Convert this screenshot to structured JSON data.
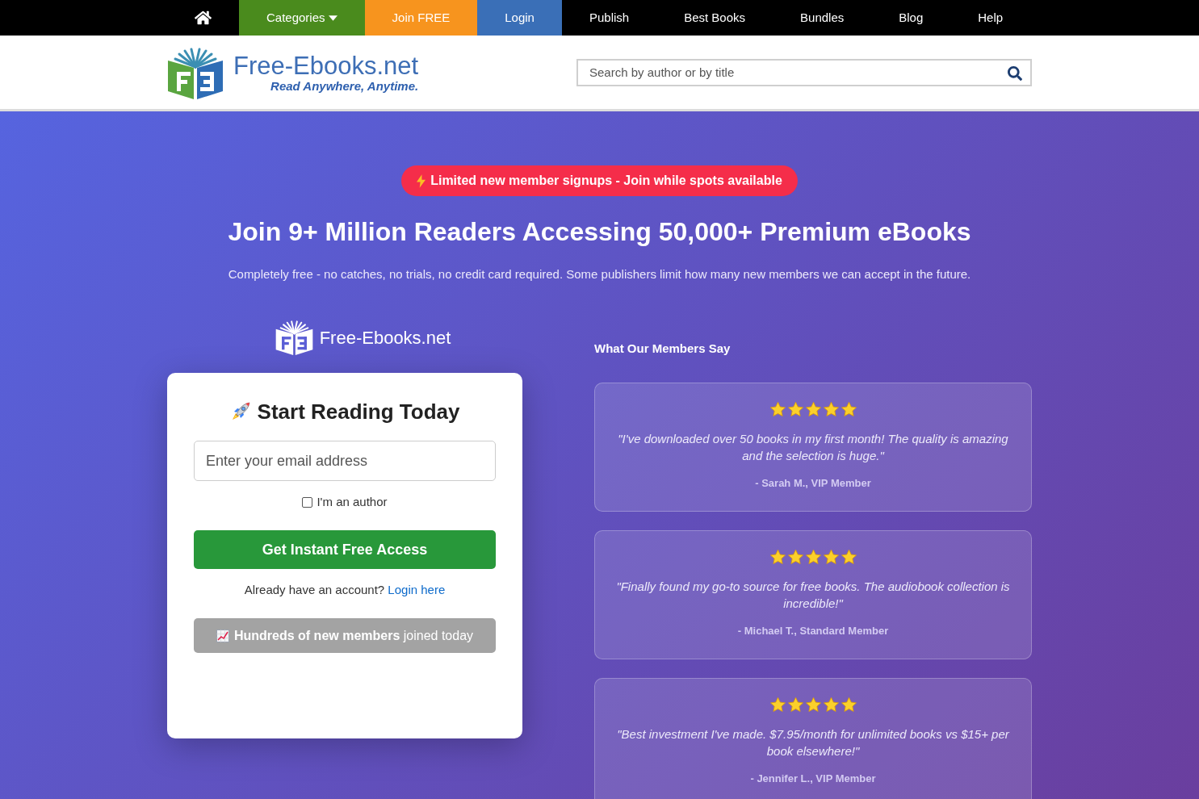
{
  "nav": {
    "items": [
      {
        "kind": "home"
      },
      {
        "kind": "menu",
        "label": "Categories",
        "color": "#4a8b1d"
      },
      {
        "kind": "link",
        "label": "Join FREE",
        "color": "#f7941e"
      },
      {
        "kind": "link",
        "label": "Login",
        "color": "#3a6fb7"
      },
      {
        "kind": "link",
        "label": "Publish"
      },
      {
        "kind": "link",
        "label": "Best Books"
      },
      {
        "kind": "link",
        "label": "Bundles"
      },
      {
        "kind": "link",
        "label": "Blog"
      },
      {
        "kind": "link",
        "label": "Help"
      }
    ]
  },
  "header": {
    "logo": {
      "name": "Free-Ebooks.net",
      "tagline": "Read Anywhere, Anytime."
    },
    "search": {
      "placeholder": "Search by author or by title"
    }
  },
  "hero": {
    "alert": "Limited new member signups - Join while spots available",
    "title": "Join 9+ Million Readers Accessing 50,000+ Premium eBooks",
    "subtitle": "Completely free - no catches, no trials, no credit card required. Some publishers limit how many new members we can accept in the future."
  },
  "signup": {
    "logo": {
      "name": "Free-Ebooks.net"
    },
    "title": "Start Reading Today",
    "email": {
      "placeholder": "Enter your email address"
    },
    "author_checkbox": {
      "label": "I'm an author",
      "checked": false
    },
    "submit": "Get Instant Free Access",
    "login_prompt": "Already have an account?",
    "login_link": "Login here",
    "social_proof": "**Hundreds of new members** joined today"
  },
  "testimonials": {
    "title": "What Our Members Say",
    "items": [
      {
        "stars": 5,
        "quote": "\"I've downloaded over 50 books in my first month! The quality is amazing and the selection is huge.\"",
        "author": "- Sarah M., VIP Member"
      },
      {
        "stars": 5,
        "quote": "\"Finally found my go-to source for free books. The audiobook collection is incredible!\"",
        "author": "- Michael T., Standard Member"
      },
      {
        "stars": 5,
        "quote": "\"Best investment I've made. $7.95/month for unlimited books vs $15+ per book elsewhere!\"",
        "author": "- Jennifer L., VIP Member"
      }
    ]
  }
}
